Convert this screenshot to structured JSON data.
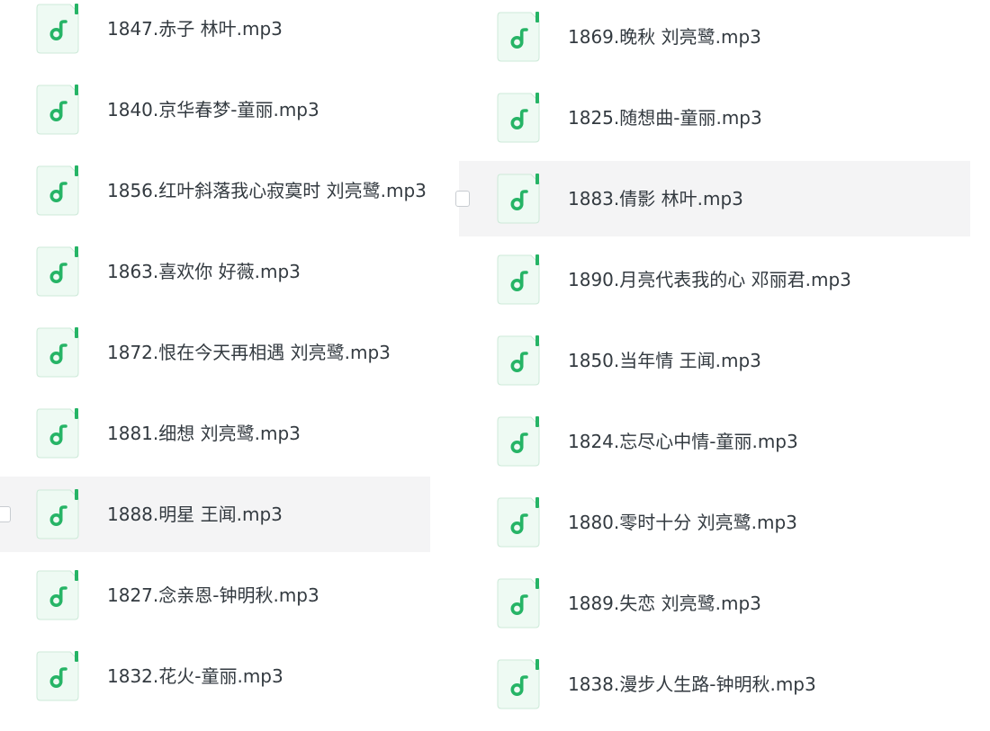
{
  "colors": {
    "icon_green": "#26b466",
    "icon_bg": "#eefaf3",
    "icon_border": "#cde9d8",
    "text": "#333a40",
    "row_hover": "#f4f4f5"
  },
  "icon": "music-file-icon",
  "columns": [
    {
      "files": [
        {
          "name": "1847.赤子 林叶.mp3",
          "hovered": false
        },
        {
          "name": "1840.京华春梦-童丽.mp3",
          "hovered": false
        },
        {
          "name": "1856.红叶斜落我心寂寞时 刘亮鹭.mp3",
          "hovered": false
        },
        {
          "name": "1863.喜欢你 好薇.mp3",
          "hovered": false
        },
        {
          "name": "1872.恨在今天再相遇 刘亮鹭.mp3",
          "hovered": false
        },
        {
          "name": "1881.细想 刘亮鹭.mp3",
          "hovered": false
        },
        {
          "name": "1888.明星 王闻.mp3",
          "hovered": true
        },
        {
          "name": "1827.念亲恩-钟明秋.mp3",
          "hovered": false
        },
        {
          "name": "1832.花火-童丽.mp3",
          "hovered": false
        }
      ]
    },
    {
      "files": [
        {
          "name": "1869.晚秋 刘亮鹭.mp3",
          "hovered": false
        },
        {
          "name": "1825.随想曲-童丽.mp3",
          "hovered": false
        },
        {
          "name": "1883.倩影 林叶.mp3",
          "hovered": true
        },
        {
          "name": "1890.月亮代表我的心 邓丽君.mp3",
          "hovered": false
        },
        {
          "name": "1850.当年情 王闻.mp3",
          "hovered": false
        },
        {
          "name": "1824.忘尽心中情-童丽.mp3",
          "hovered": false
        },
        {
          "name": "1880.零时十分 刘亮鹭.mp3",
          "hovered": false
        },
        {
          "name": "1889.失恋 刘亮鹭.mp3",
          "hovered": false
        },
        {
          "name": "1838.漫步人生路-钟明秋.mp3",
          "hovered": false
        }
      ]
    }
  ]
}
